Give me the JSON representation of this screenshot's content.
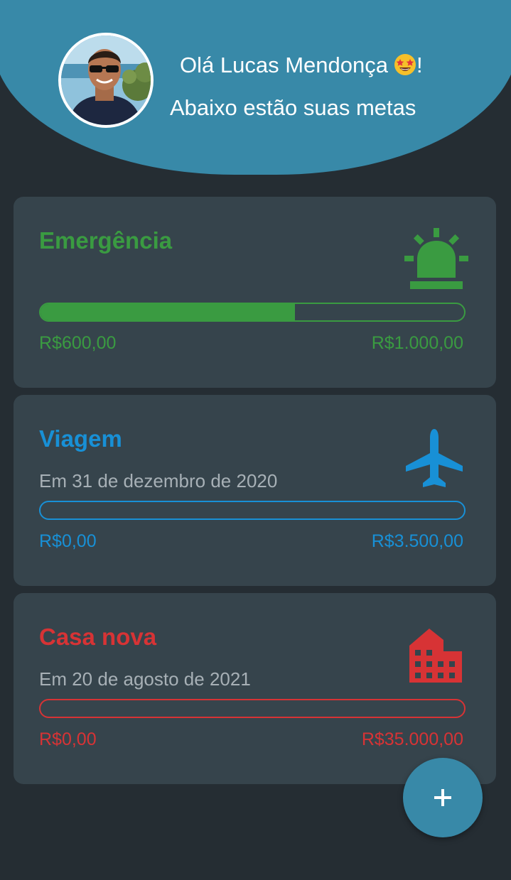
{
  "header": {
    "greeting": "Olá Lucas Mendonça",
    "greeting_suffix": "!",
    "subtitle": "Abaixo estão suas metas",
    "emoji_icon": "star-struck-emoji-icon",
    "background_color": "#3889a8"
  },
  "goals": [
    {
      "title": "Emergência",
      "date_text": "",
      "current": "R$600,00",
      "target": "R$1.000,00",
      "progress": 0.6,
      "color": "#3a9b41",
      "icon": "siren-icon"
    },
    {
      "title": "Viagem",
      "date_text": "Em 31 de dezembro de 2020",
      "current": "R$0,00",
      "target": "R$3.500,00",
      "progress": 0,
      "color": "#1890d6",
      "icon": "airplane-icon"
    },
    {
      "title": "Casa nova",
      "date_text": "Em 20 de agosto de 2021",
      "current": "R$0,00",
      "target": "R$35.000,00",
      "progress": 0,
      "color": "#d73335",
      "icon": "building-icon"
    }
  ],
  "fab": {
    "label": "+",
    "icon": "plus-icon"
  }
}
